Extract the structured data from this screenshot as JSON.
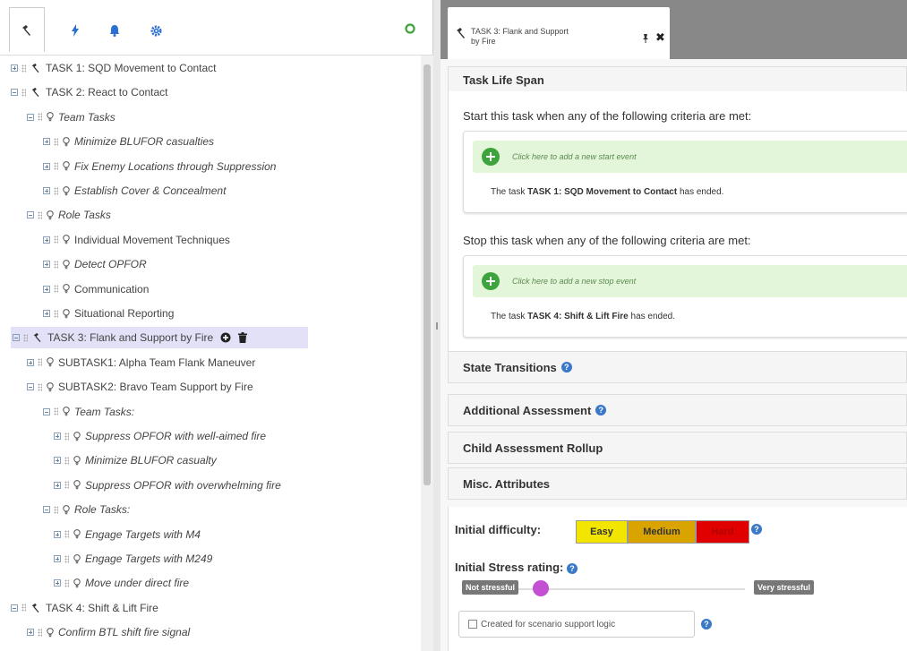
{
  "toolbar": {
    "tabs": [
      {
        "icon": "hammer-icon"
      },
      {
        "icon": "bolt-icon"
      },
      {
        "icon": "bell-icon"
      },
      {
        "icon": "gear-icon"
      }
    ],
    "refresh_icon": "refresh-icon"
  },
  "tree": [
    {
      "label": "TASK 1: SQD Movement to Contact",
      "level": 0,
      "kind": "task",
      "expanded": false,
      "italic": false
    },
    {
      "label": "TASK 2: React to Contact",
      "level": 0,
      "kind": "task",
      "expanded": true,
      "italic": false
    },
    {
      "label": "Team Tasks",
      "level": 1,
      "kind": "concept",
      "expanded": true,
      "italic": true
    },
    {
      "label": "Minimize BLUFOR casualties",
      "level": 2,
      "kind": "concept",
      "expanded": false,
      "italic": true
    },
    {
      "label": "Fix Enemy Locations through Suppression",
      "level": 2,
      "kind": "concept",
      "expanded": false,
      "italic": true
    },
    {
      "label": "Establish Cover & Concealment",
      "level": 2,
      "kind": "concept",
      "expanded": false,
      "italic": true
    },
    {
      "label": "Role Tasks",
      "level": 1,
      "kind": "concept",
      "expanded": true,
      "italic": true
    },
    {
      "label": "Individual Movement Techniques",
      "level": 2,
      "kind": "concept",
      "expanded": false,
      "italic": false
    },
    {
      "label": "Detect OPFOR",
      "level": 2,
      "kind": "concept",
      "expanded": false,
      "italic": true
    },
    {
      "label": "Communication",
      "level": 2,
      "kind": "concept",
      "expanded": false,
      "italic": false
    },
    {
      "label": "Situational Reporting",
      "level": 2,
      "kind": "concept",
      "expanded": false,
      "italic": false
    },
    {
      "label": "TASK 3: Flank and Support by Fire",
      "level": 0,
      "kind": "task",
      "expanded": true,
      "italic": false,
      "selected": true
    },
    {
      "label": "SUBTASK1: Alpha Team Flank Maneuver",
      "level": 1,
      "kind": "concept",
      "expanded": false,
      "italic": false
    },
    {
      "label": "SUBTASK2: Bravo Team Support by Fire",
      "level": 1,
      "kind": "concept",
      "expanded": true,
      "italic": false
    },
    {
      "label": "Team Tasks:",
      "level": 2,
      "kind": "concept",
      "expanded": true,
      "italic": true
    },
    {
      "label": "Suppress OPFOR with well-aimed fire",
      "level": 3,
      "kind": "concept",
      "expanded": false,
      "italic": true
    },
    {
      "label": "Minimize BLUFOR casualty",
      "level": 3,
      "kind": "concept",
      "expanded": false,
      "italic": true
    },
    {
      "label": "Suppress OPFOR with overwhelming fire",
      "level": 3,
      "kind": "concept",
      "expanded": false,
      "italic": true
    },
    {
      "label": "Role Tasks:",
      "level": 2,
      "kind": "concept",
      "expanded": true,
      "italic": true
    },
    {
      "label": "Engage Targets with M4",
      "level": 3,
      "kind": "concept",
      "expanded": false,
      "italic": true
    },
    {
      "label": "Engage Targets with M249",
      "level": 3,
      "kind": "concept",
      "expanded": false,
      "italic": true
    },
    {
      "label": "Move under direct fire",
      "level": 3,
      "kind": "concept",
      "expanded": false,
      "italic": true
    },
    {
      "label": "TASK 4: Shift & Lift Fire",
      "level": 0,
      "kind": "task",
      "expanded": true,
      "italic": false
    },
    {
      "label": "Confirm BTL shift fire signal",
      "level": 1,
      "kind": "concept",
      "expanded": false,
      "italic": true
    }
  ],
  "tab": {
    "title_line1": "TASK 3: Flank and Support",
    "title_line2": "by Fire",
    "close": "✖"
  },
  "lifespan": {
    "header": "Task Life Span",
    "start_criteria": "Start this task when any of the following criteria are met:",
    "start_add": "Click here to add a new start event",
    "start_event_pre": "The task ",
    "start_event_task": "TASK 1: SQD Movement to Contact",
    "start_event_post": " has ended.",
    "stop_criteria": "Stop this task when any of the following criteria are met:",
    "stop_add": "Click here to add a new stop event",
    "stop_event_pre": "The task ",
    "stop_event_task": "TASK 4: Shift & Lift Fire",
    "stop_event_post": " has ended."
  },
  "sections": {
    "state_transitions": "State Transitions",
    "additional_assessment": "Additional Assessment",
    "child_rollup": "Child Assessment Rollup",
    "misc": "Misc. Attributes"
  },
  "misc": {
    "difficulty_label": "Initial difficulty:",
    "difficulty_options": [
      {
        "label": "Easy",
        "color": "#f2e600"
      },
      {
        "label": "Medium",
        "color": "#d9a400"
      },
      {
        "label": "Hard",
        "color": "#e10000"
      }
    ],
    "stress_label": "Initial Stress rating:",
    "stress_min": "Not stressful",
    "stress_max": "Very stressful",
    "stress_value": 0.28,
    "support_logic": "Created for scenario support logic"
  },
  "colors": {
    "accent_blue": "#3a78c8",
    "selected_bg": "#e3e1f7",
    "add_green": "#3da33d",
    "slider_knob": "#c34fd3"
  }
}
